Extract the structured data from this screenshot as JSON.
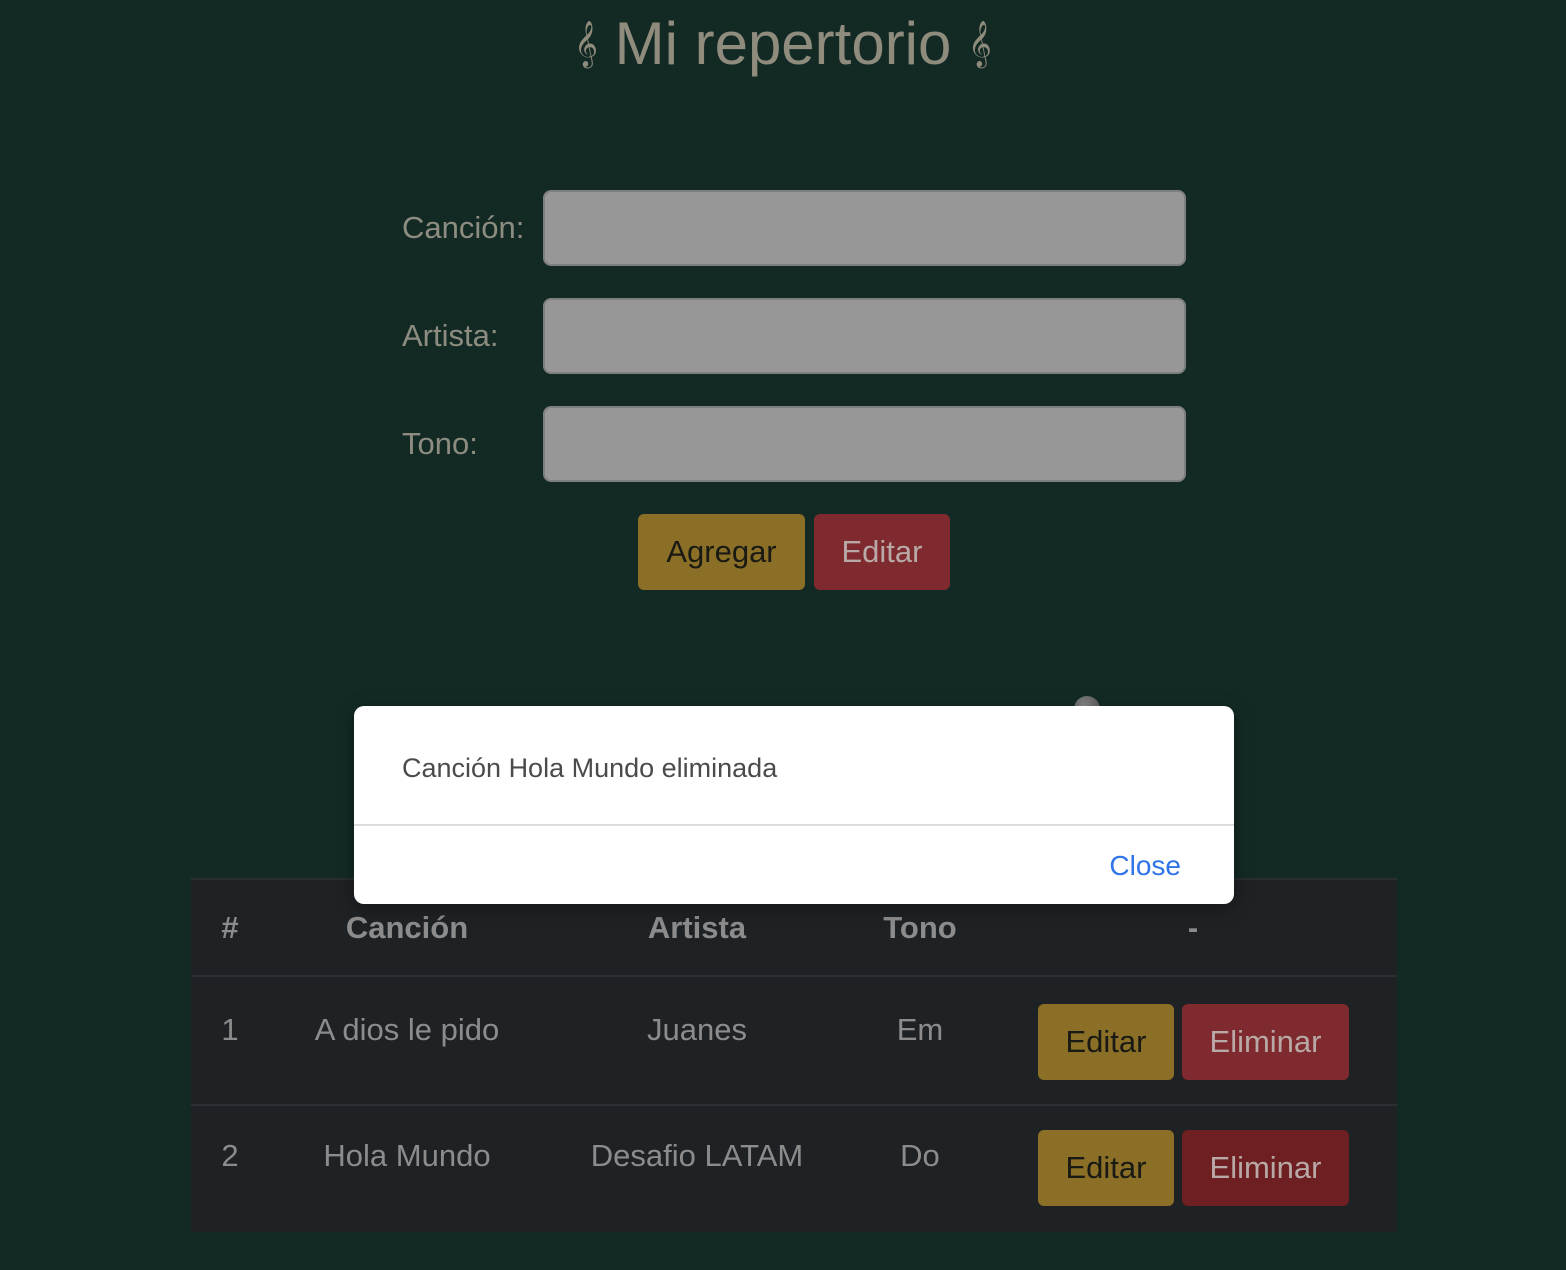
{
  "header": {
    "title": "Mi repertorio",
    "clef_left": "𝄞",
    "clef_right": "𝄞"
  },
  "form": {
    "song_label": "Canción:",
    "song_value": "",
    "artist_label": "Artista:",
    "artist_value": "",
    "key_label": "Tono:",
    "key_value": "",
    "add_button": "Agregar",
    "edit_button": "Editar"
  },
  "table": {
    "columns": [
      "#",
      "Canción",
      "Artista",
      "Tono",
      "-"
    ],
    "rows": [
      {
        "num": "1",
        "song": "A dios le pido",
        "artist": "Juanes",
        "key": "Em",
        "edit": "Editar",
        "delete": "Eliminar"
      },
      {
        "num": "2",
        "song": "Hola Mundo",
        "artist": "Desafio LATAM",
        "key": "Do",
        "edit": "Editar",
        "delete": "Eliminar"
      }
    ]
  },
  "modal": {
    "message": "Canción Hola Mundo eliminada",
    "close_label": "Close"
  },
  "colors": {
    "background": "#132a24",
    "warning": "#8b6f27",
    "danger": "#7f2a2f",
    "link": "#2f74e8"
  }
}
